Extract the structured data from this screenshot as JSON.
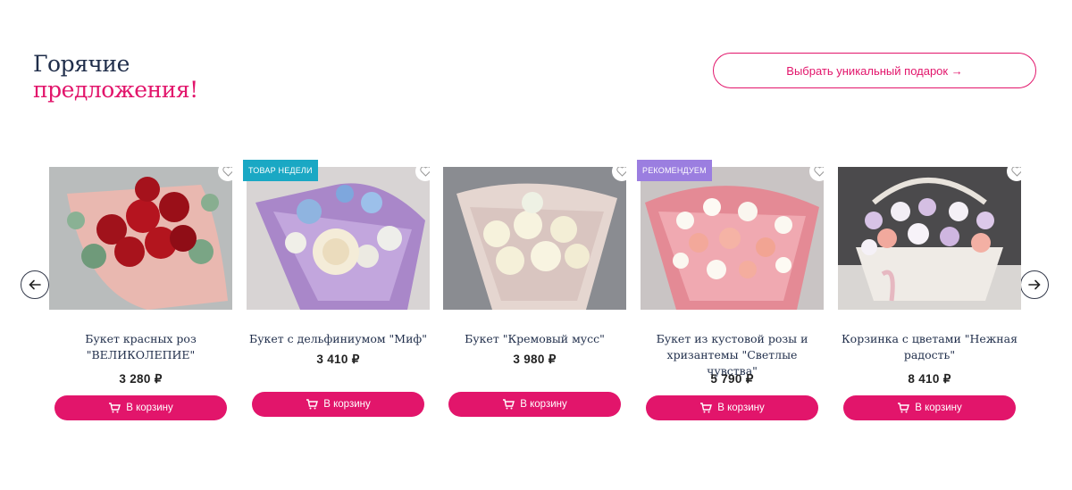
{
  "section": {
    "title_line1": "Горячие",
    "title_line2": "предложения!",
    "cta_label": "Выбрать уникальный подарок →"
  },
  "carousel": {
    "prev_icon": "arrow-left-icon",
    "next_icon": "arrow-right-icon"
  },
  "products": [
    {
      "name": "Букет красных роз \"ВЕЛИКОЛЕПИЕ\"",
      "price": "3 280 ₽",
      "button": "В корзину",
      "badge": ""
    },
    {
      "name": "Букет с дельфиниумом \"Миф\"",
      "price": "3 410 ₽",
      "button": "В корзину",
      "badge": "ТОВАР НЕДЕЛИ"
    },
    {
      "name": "Букет \"Кремовый мусс\"",
      "price": "3 980 ₽",
      "button": "В корзину",
      "badge": ""
    },
    {
      "name": "Букет из кустовой розы и хризантемы \"Светлые чувства\"",
      "price": "5 790 ₽",
      "button": "В корзину",
      "badge": "РЕКОМЕНДУЕМ"
    },
    {
      "name": "Корзинка с цветами \"Нежная радость\"",
      "price": "8 410 ₽",
      "button": "В корзину",
      "badge": ""
    }
  ],
  "colors": {
    "accent": "#e2156b",
    "title_dark": "#1f2d4a",
    "badge_week": "#1aa8c4",
    "badge_recommend": "#9b7ee0"
  }
}
